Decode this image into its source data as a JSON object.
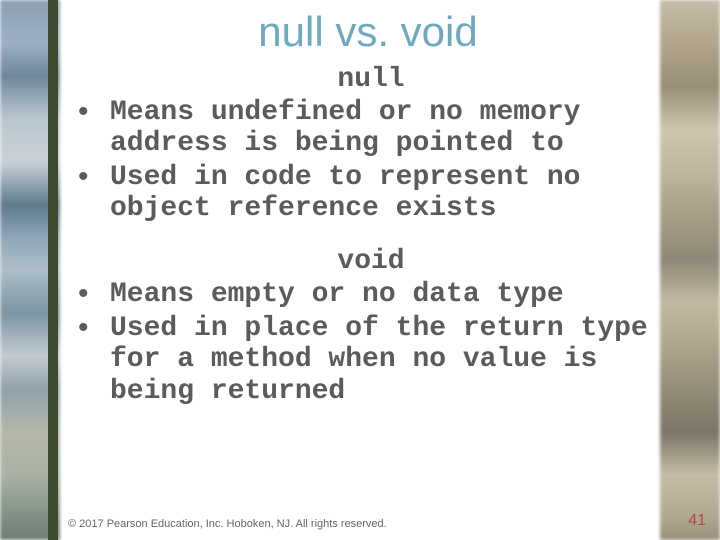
{
  "title": "null vs. void",
  "section1": {
    "heading": "null",
    "bullets": [
      "Means undefined or no memory address is being pointed to",
      "Used in code to represent no object reference exists"
    ]
  },
  "section2": {
    "heading": "void",
    "bullets": [
      "Means empty or no data type",
      "Used in place of the return type for a method when no value is being returned"
    ]
  },
  "footer": "© 2017 Pearson Education, Inc. Hoboken, NJ. All rights reserved.",
  "page_number": "41"
}
